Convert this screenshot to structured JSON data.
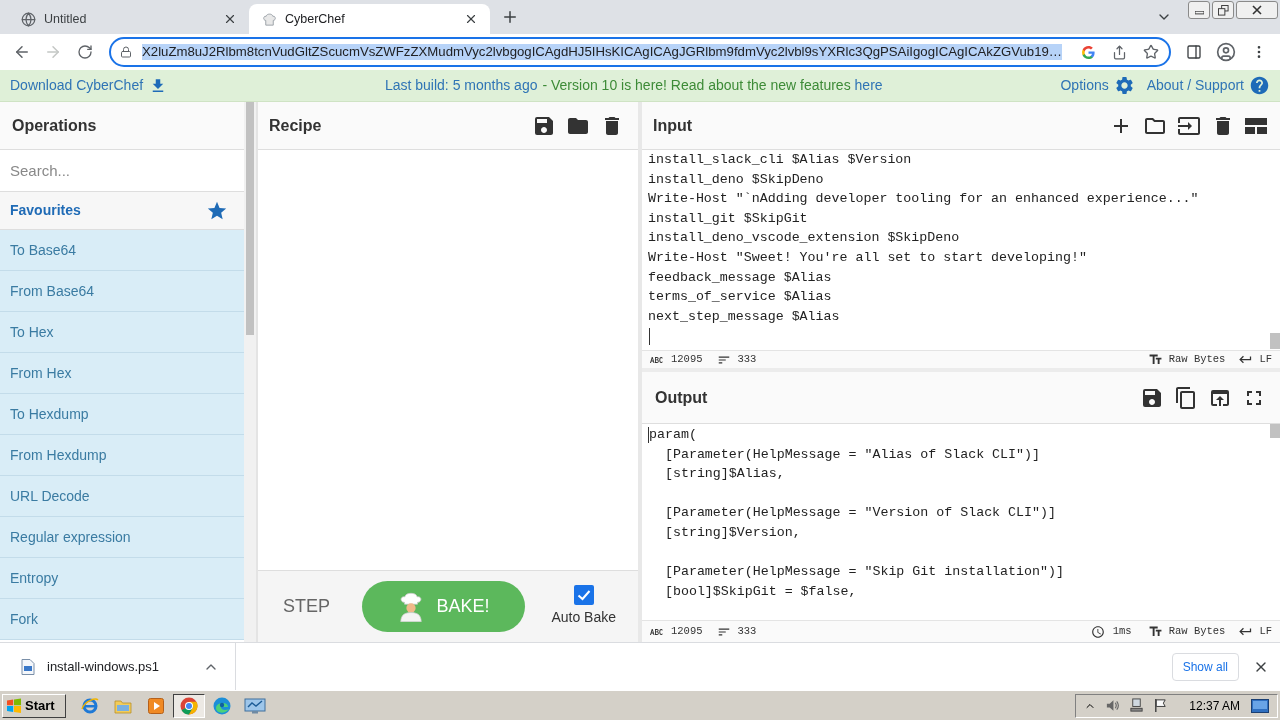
{
  "browser": {
    "tabs": [
      {
        "title": "Untitled",
        "selected": false
      },
      {
        "title": "CyberChef",
        "selected": true
      }
    ],
    "url": "X2luZm8uJ2Rlbm8tcnVudGltZScucmVsZWFzZXMudmVyc2lvbgogICAgdHJ5IHsKICAgICAgJGRlbm9fdmVyc2lvbl9sYXRlc3QgPSAiIgogICAgICAkZGVub19…"
  },
  "banner": {
    "download": "Download CyberChef",
    "last_build": "Last build: 5 months ago",
    "notice": "- Version 10 is here! Read about the new features",
    "notice_link": "here",
    "options": "Options",
    "about": "About / Support"
  },
  "operations": {
    "title": "Operations",
    "search": {
      "placeholder": "Search..."
    },
    "favourites": "Favourites",
    "items": [
      "To Base64",
      "From Base64",
      "To Hex",
      "From Hex",
      "To Hexdump",
      "From Hexdump",
      "URL Decode",
      "Regular expression",
      "Entropy",
      "Fork"
    ]
  },
  "recipe": {
    "title": "Recipe",
    "step": "STEP",
    "bake": "BAKE!",
    "auto_bake": {
      "label": "Auto Bake",
      "checked": true
    }
  },
  "input": {
    "title": "Input",
    "lines": [
      "install_slack_cli $Alias $Version",
      "install_deno $SkipDeno",
      "Write-Host \"`nAdding developer tooling for an enhanced experience...\"",
      "install_git $SkipGit",
      "install_deno_vscode_extension $SkipDeno",
      "Write-Host \"Sweet! You're all set to start developing!\"",
      "feedback_message $Alias",
      "terms_of_service $Alias",
      "next_step_message $Alias"
    ],
    "status": {
      "length": "12095",
      "lines": "333",
      "format": "Raw Bytes",
      "eol": "LF"
    }
  },
  "output": {
    "title": "Output",
    "blocks": [
      [
        "param(",
        "  [Parameter(HelpMessage = \"Alias of Slack CLI\")]",
        "  [string]$Alias,"
      ],
      [
        "  [Parameter(HelpMessage = \"Version of Slack CLI\")]",
        "  [string]$Version,"
      ],
      [
        "  [Parameter(HelpMessage = \"Skip Git installation\")]",
        "  [bool]$SkipGit = $false,"
      ]
    ],
    "status": {
      "length": "12095",
      "lines": "333",
      "time": "1ms",
      "format": "Raw Bytes",
      "eol": "LF"
    }
  },
  "download_bar": {
    "file": "install-windows.ps1",
    "show_all": "Show all"
  },
  "taskbar": {
    "start": "Start",
    "apps": [
      {
        "selected": false
      },
      {
        "selected": false
      },
      {
        "selected": false
      },
      {
        "selected": true
      },
      {
        "selected": false
      },
      {
        "selected": false
      }
    ],
    "clock": "12:37 AM"
  }
}
